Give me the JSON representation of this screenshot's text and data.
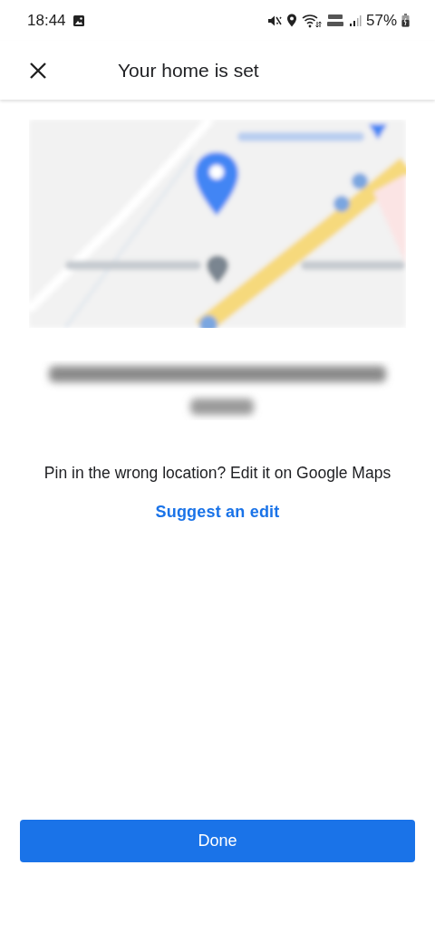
{
  "status_bar": {
    "time": "18:44",
    "battery": "57%"
  },
  "header": {
    "title": "Your home is set"
  },
  "message": "Pin in the wrong location? Edit it on Google Maps",
  "link": "Suggest an edit",
  "buttons": [
    "Done"
  ]
}
